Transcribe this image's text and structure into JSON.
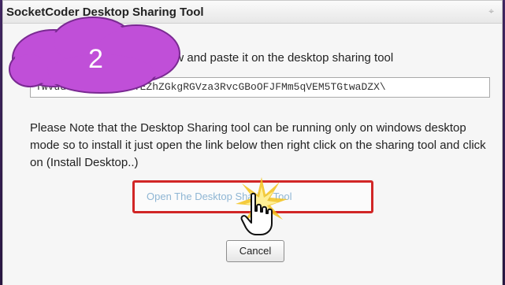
{
  "dialog": {
    "title": "SocketCoder Desktop Sharing Tool",
    "instruction": "below and paste it on the desktop sharing tool",
    "token_value": "TWVudGlvbjoSb29tYEZhZGkgRGVza3RvcGBoOFJFMm5qVEM5TGtwaDZX\\",
    "note": "Please Note that the Desktop Sharing tool can be running only on windows desktop mode so to install it just open the link below then right click on the sharing tool and click on (Install Desktop..)",
    "open_link_label": "Open The Desktop Sharing Tool",
    "cancel_label": "Cancel",
    "close_icon": "close-icon"
  },
  "annotation": {
    "step_number": "2",
    "cloud_color": "#c04fd8",
    "highlight_color": "#d12626"
  },
  "colors": {
    "background": "#3a2459",
    "link": "#8fb6d4"
  }
}
